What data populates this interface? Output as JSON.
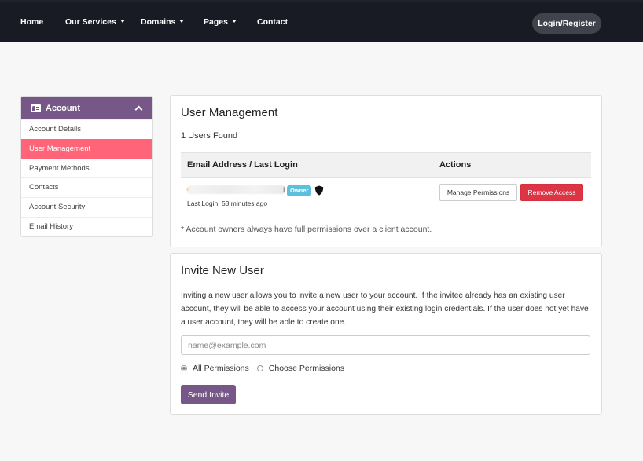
{
  "nav": {
    "items": [
      {
        "label": "Home",
        "has_dropdown": false
      },
      {
        "label": "Our Services",
        "has_dropdown": true
      },
      {
        "label": "Domains",
        "has_dropdown": true
      },
      {
        "label": "Pages",
        "has_dropdown": true
      },
      {
        "label": "Contact",
        "has_dropdown": false
      }
    ],
    "login_label": "Login/Register"
  },
  "sidebar": {
    "title": "Account",
    "icon": "id-card-icon",
    "items": [
      {
        "label": "Account Details",
        "active": false
      },
      {
        "label": "User Management",
        "active": true
      },
      {
        "label": "Payment Methods",
        "active": false
      },
      {
        "label": "Contacts",
        "active": false
      },
      {
        "label": "Account Security",
        "active": false
      },
      {
        "label": "Email History",
        "active": false
      }
    ]
  },
  "user_management": {
    "title": "User Management",
    "count_text": "1 Users Found",
    "columns": [
      "Email Address / Last Login",
      "Actions"
    ],
    "rows": [
      {
        "email": "[redacted]",
        "badge": "Owner",
        "badge_icon": "shield-icon",
        "last_login": "Last Login: 53 minutes ago",
        "actions": [
          "Manage Permissions",
          "Remove Access"
        ]
      }
    ],
    "note": "* Account owners always have full permissions over a client account."
  },
  "invite": {
    "title": "Invite New User",
    "description": "Inviting a new user allows you to invite a new user to your account. If the invitee already has an existing user account, they will be able to access your account using their existing login credentials. If the user does not yet have a user account, they will be able to create one.",
    "email_placeholder": "name@example.com",
    "email_value": "",
    "permission_options": [
      {
        "label": "All Permissions",
        "checked": true
      },
      {
        "label": "Choose Permissions",
        "checked": false
      }
    ],
    "send_label": "Send Invite"
  },
  "colors": {
    "nav_bg": "#181a24",
    "brand_purple": "#765787",
    "active_pink": "#ff6479",
    "danger_red": "#dc3545",
    "owner_badge": "#5bc0de",
    "page_bg": "#f7f7f7"
  }
}
